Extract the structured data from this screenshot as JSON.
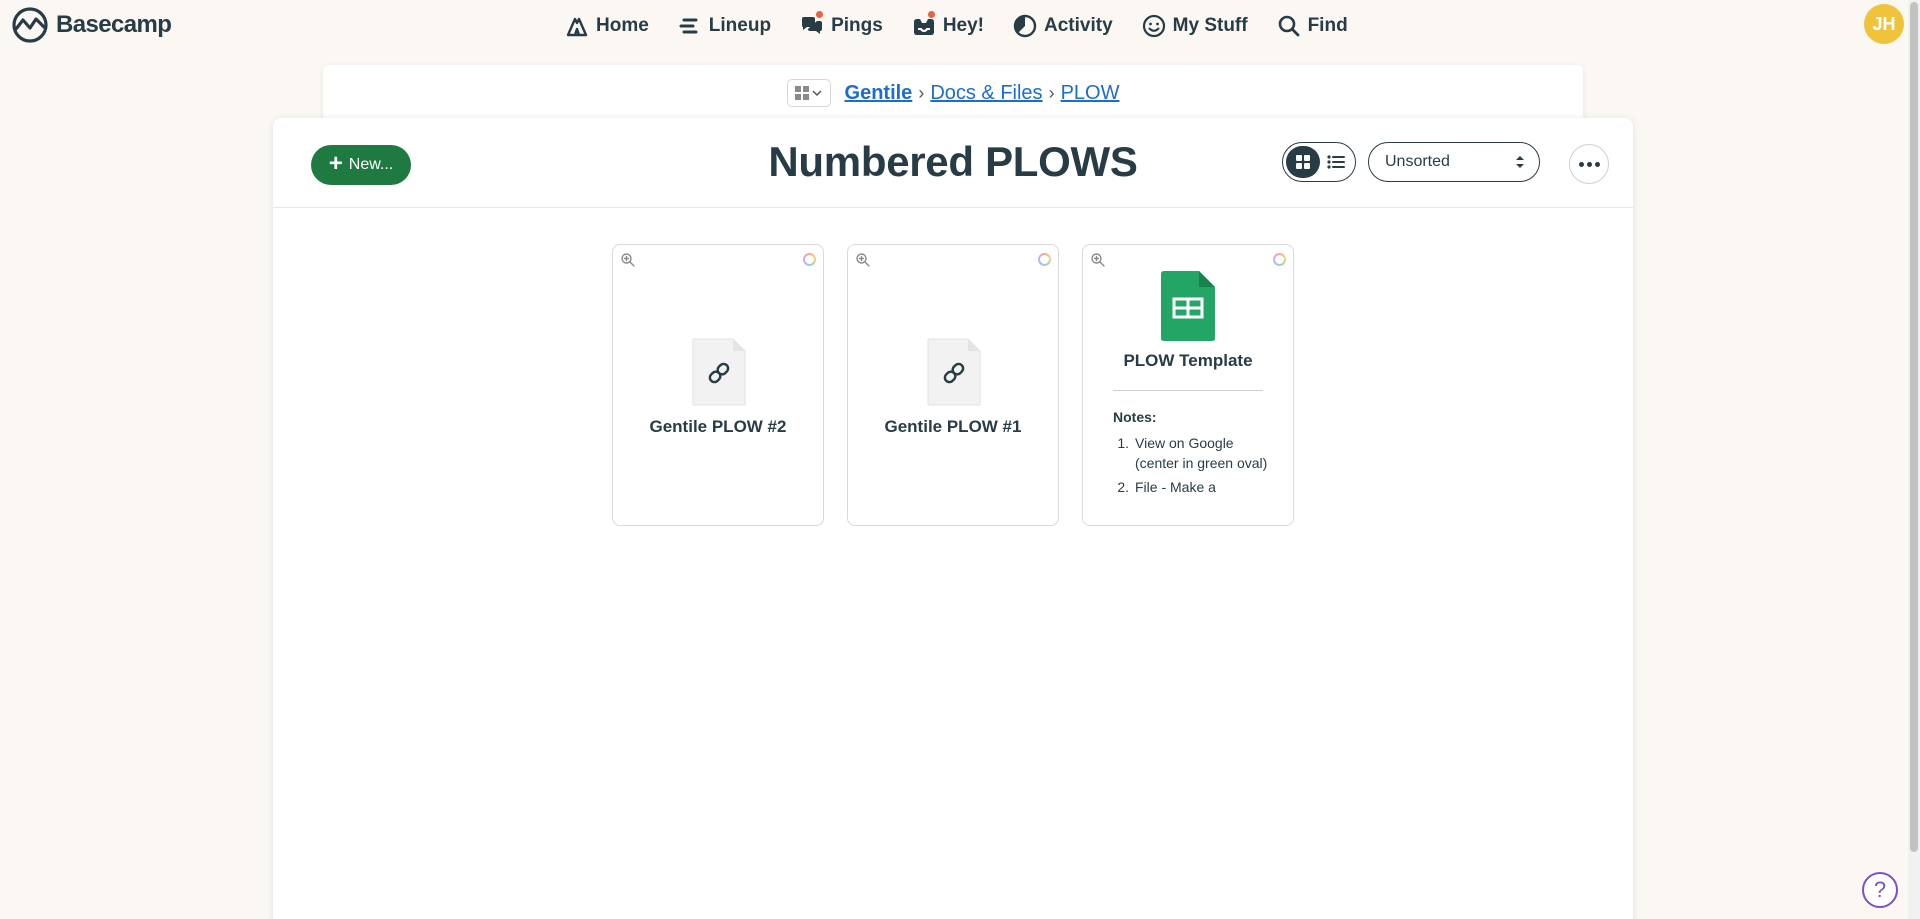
{
  "app": {
    "name": "Basecamp"
  },
  "nav": {
    "home": "Home",
    "lineup": "Lineup",
    "pings": "Pings",
    "hey": "Hey!",
    "activity": "Activity",
    "mystuff": "My Stuff",
    "find": "Find"
  },
  "user": {
    "initials": "JH",
    "color": "#f0c33c"
  },
  "breadcrumb": {
    "project": "Gentile",
    "section": "Docs & Files",
    "folder": "PLOW",
    "separator": "›"
  },
  "toolbar": {
    "new_label": "New...",
    "sort_value": "Unsorted"
  },
  "page": {
    "title": "Numbered PLOWS"
  },
  "files": [
    {
      "name": "Gentile PLOW #2",
      "type": "link"
    },
    {
      "name": "Gentile PLOW #1",
      "type": "link"
    },
    {
      "name": "PLOW Template",
      "type": "google-sheet",
      "notes_title": "Notes:",
      "notes": [
        {
          "num": "1.",
          "text": "View on Google (center in green oval)"
        },
        {
          "num": "2.",
          "text": "File - Make a"
        }
      ]
    }
  ],
  "help": {
    "label": "?"
  },
  "colors": {
    "accent": "#1f7a42",
    "link": "#1d6cd1",
    "notification": "#ef5e3f",
    "help": "#7b51c9"
  }
}
